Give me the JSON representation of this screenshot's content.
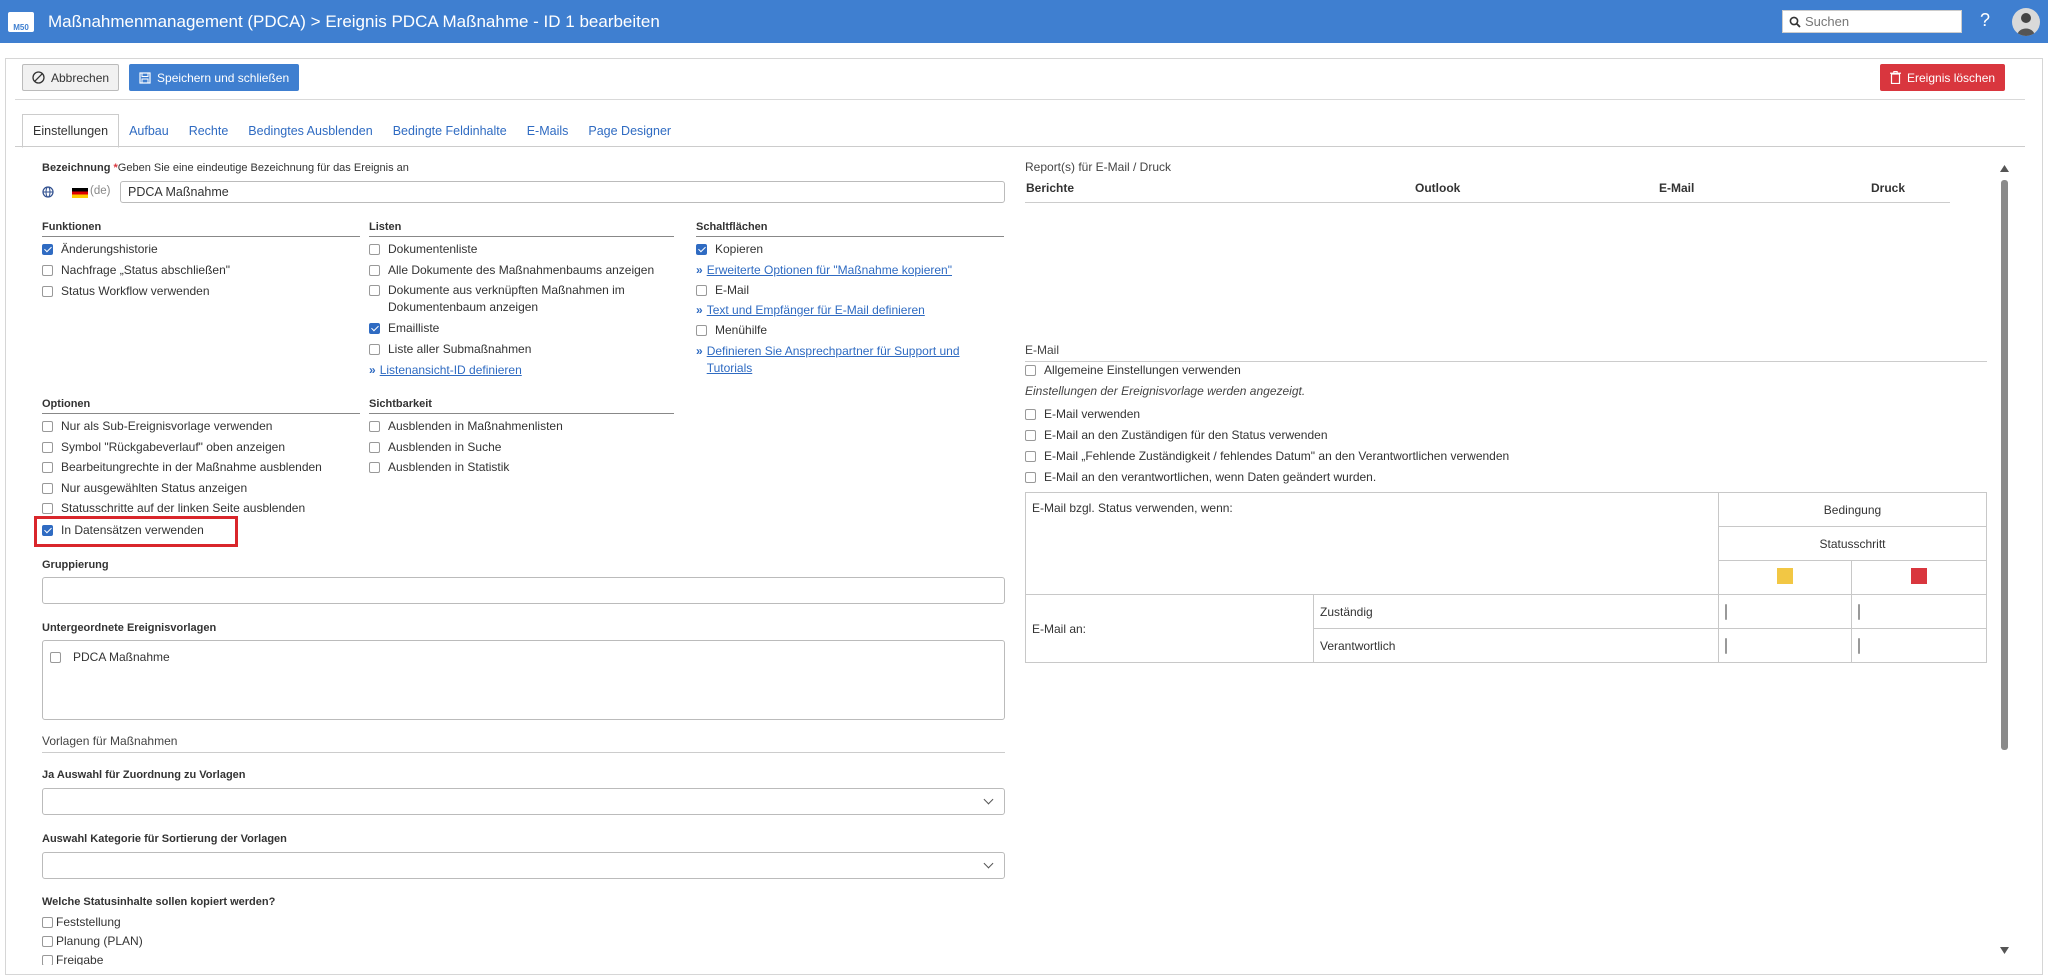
{
  "header": {
    "title": "Maßnahmenmanagement (PDCA) > Ereignis PDCA Maßnahme - ID 1 bearbeiten",
    "logo_text": "M50",
    "search_placeholder": "Suchen",
    "help_label": "?"
  },
  "toolbar": {
    "cancel_label": "Abbrechen",
    "save_label": "Speichern und schließen",
    "delete_label": "Ereignis löschen"
  },
  "tabs": [
    "Einstellungen",
    "Aufbau",
    "Rechte",
    "Bedingtes Ausblenden",
    "Bedingte Feldinhalte",
    "E-Mails",
    "Page Designer"
  ],
  "bezeichnung": {
    "label": "Bezeichnung",
    "hint": "Geben Sie eine eindeutige Bezeichnung für das Ereignis an",
    "lang": "(de)",
    "value": "PDCA Maßnahme"
  },
  "funktionen": {
    "title": "Funktionen",
    "items": [
      {
        "label": "Änderungshistorie",
        "checked": true
      },
      {
        "label": "Nachfrage „Status abschließen\"",
        "checked": false
      },
      {
        "label": "Status Workflow verwenden",
        "checked": false
      }
    ]
  },
  "listen": {
    "title": "Listen",
    "items": [
      {
        "label": "Dokumentenliste",
        "checked": false
      },
      {
        "label": "Alle Dokumente des Maßnahmenbaums anzeigen",
        "checked": false
      },
      {
        "label": "Dokumente aus verknüpften Maßnahmen im Dokumentenbaum anzeigen",
        "checked": false
      },
      {
        "label": "Emailliste",
        "checked": true
      },
      {
        "label": "Liste aller Submaßnahmen",
        "checked": false
      }
    ],
    "link": "Listenansicht-ID definieren"
  },
  "schaltflaechen": {
    "title": "Schaltflächen",
    "kopieren": "Kopieren",
    "link1": "Erweiterte Optionen für \"Maßnahme kopieren\"",
    "email": "E-Mail",
    "link2": "Text und Empfänger für E-Mail definieren",
    "menuehilfe": "Menühilfe",
    "link3": "Definieren Sie Ansprechpartner für Support und Tutorials"
  },
  "optionen": {
    "title": "Optionen",
    "items": [
      {
        "label": "Nur als Sub-Ereignisvorlage verwenden",
        "checked": false
      },
      {
        "label": "Symbol \"Rückgabeverlauf\" oben anzeigen",
        "checked": false
      },
      {
        "label": "Bearbeitungrechte in der Maßnahme ausblenden",
        "checked": false
      },
      {
        "label": "Nur ausgewählten Status anzeigen",
        "checked": false
      },
      {
        "label": "Statusschritte auf der linken Seite ausblenden",
        "checked": false
      },
      {
        "label": "In Datensätzen verwenden",
        "checked": true
      }
    ]
  },
  "sichtbarkeit": {
    "title": "Sichtbarkeit",
    "items": [
      {
        "label": "Ausblenden in Maßnahmenlisten",
        "checked": false
      },
      {
        "label": "Ausblenden in Suche",
        "checked": false
      },
      {
        "label": "Ausblenden in Statistik",
        "checked": false
      }
    ]
  },
  "gruppierung": {
    "label": "Gruppierung"
  },
  "untergeordnete": {
    "label": "Untergeordnete Ereignisvorlagen",
    "item": "PDCA Maßnahme"
  },
  "vorlagen": {
    "title": "Vorlagen für Maßnahmen",
    "ja_label": "Ja Auswahl für Zuordnung zu Vorlagen",
    "kategorie_label": "Auswahl Kategorie für Sortierung der Vorlagen"
  },
  "statusinhalte": {
    "label": "Welche Statusinhalte sollen kopiert werden?",
    "items": [
      "Feststellung",
      "Planung (PLAN)",
      "Freigabe"
    ]
  },
  "reports": {
    "title": "Report(s) für E-Mail / Druck",
    "columns": [
      "Berichte",
      "Outlook",
      "E-Mail",
      "Druck"
    ]
  },
  "email": {
    "title": "E-Mail",
    "allgemein": "Allgemeine Einstellungen verwenden",
    "note": "Einstellungen der Ereignisvorlage werden angezeigt.",
    "options": [
      "E-Mail verwenden",
      "E-Mail an den Zuständigen für den Status verwenden",
      "E-Mail „Fehlende Zuständigkeit / fehlendes Datum\" an den Verantwortlichen verwenden",
      "E-Mail an den verantwortlichen, wenn Daten geändert wurden."
    ]
  },
  "status_table": {
    "header": "E-Mail bzgl. Status verwenden, wenn:",
    "bedingung": "Bedingung",
    "statusschritt": "Statusschritt",
    "email_an": "E-Mail an:",
    "rows": [
      "Zuständig",
      "Verantwortlich"
    ]
  },
  "colors": {
    "accent": "#3f7fd0",
    "danger": "#d9363e",
    "yellow": "#f2c744",
    "red": "#d9363e",
    "highlight": "#d9262b"
  }
}
